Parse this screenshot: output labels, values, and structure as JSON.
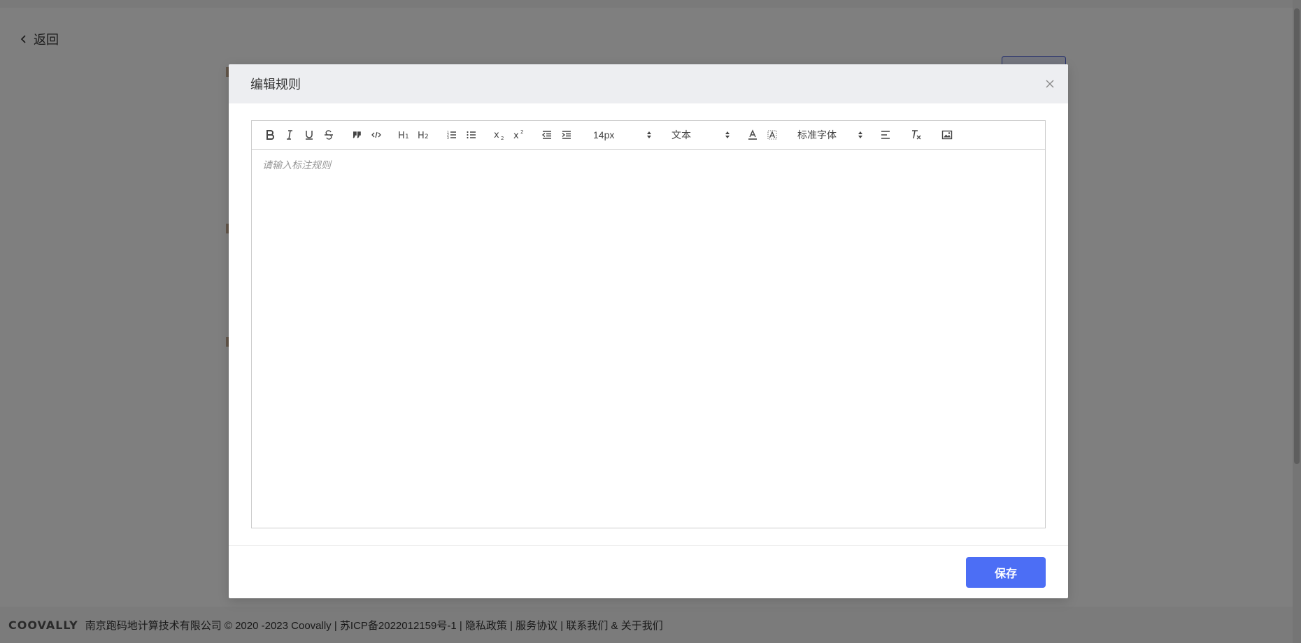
{
  "page": {
    "back_label": "返回",
    "footer": {
      "logo": "COOVALLY",
      "text": "南京跑码地计算技术有限公司 © 2020 -2023 Coovally | 苏ICP备2022012159号-1 | 隐私政策 | 服务协议 | 联系我们 & 关于我们"
    }
  },
  "modal": {
    "title": "编辑规则",
    "close_icon": "close-icon",
    "toolbar": {
      "font_size": "14px",
      "header_select": "文本",
      "font_family": "标准字体",
      "buttons": [
        "bold-icon",
        "italic-icon",
        "underline-icon",
        "strikethrough-icon",
        "blockquote-icon",
        "code-block-icon",
        "h1-icon",
        "h2-icon",
        "ordered-list-icon",
        "bullet-list-icon",
        "subscript-icon",
        "superscript-icon",
        "outdent-icon",
        "indent-icon",
        "font-color-icon",
        "background-color-icon",
        "align-icon",
        "clear-format-icon",
        "image-icon"
      ]
    },
    "editor_placeholder": "请输入标注规则",
    "save_label": "保存"
  },
  "colors": {
    "primary": "#4c6ef5",
    "overlay": "rgba(0,0,0,0.5)",
    "modal_header": "#edeef1"
  }
}
